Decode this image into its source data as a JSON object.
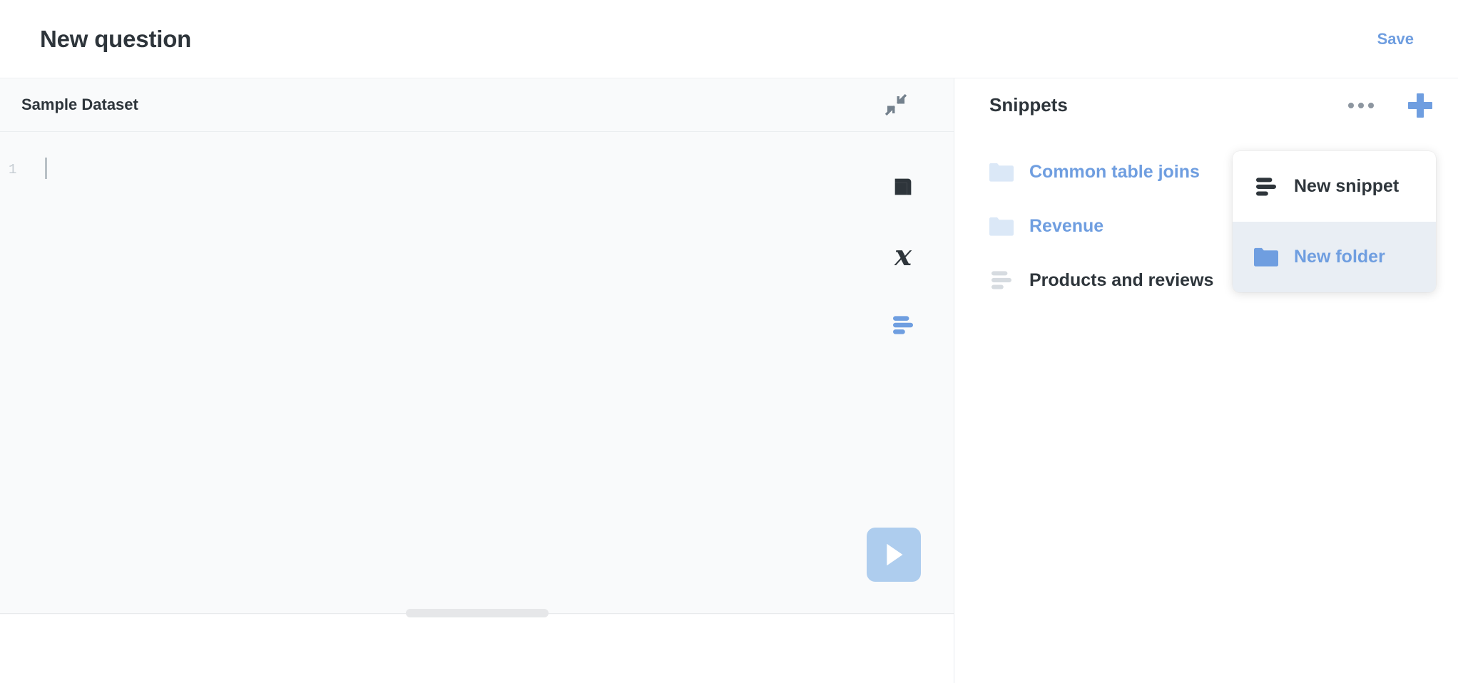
{
  "header": {
    "title": "New question",
    "save_label": "Save",
    "save_color": "#6f9ee0",
    "title_color": "#2e353b"
  },
  "editor": {
    "dataset_name": "Sample Dataset",
    "collapse_icon": "collapse-arrows-icon",
    "line_number": "1",
    "code_value": "",
    "rail_icons": [
      {
        "name": "data-reference-icon",
        "color": "#2e353b"
      },
      {
        "name": "variables-icon",
        "glyph": "x",
        "color": "#2e353b"
      },
      {
        "name": "snippets-icon",
        "color": "#6f9ee0"
      }
    ],
    "run_button": {
      "name": "run-query-button",
      "icon": "play-icon",
      "background": "#aecdee"
    },
    "drag_handle": "resize-handle"
  },
  "snippets": {
    "title": "Snippets",
    "ellipsis_icon": "ellipsis-icon",
    "plus_icon": "plus-icon",
    "plus_color": "#6f9ee0",
    "items": [
      {
        "label": "Common table joins",
        "type": "folder",
        "icon": "folder-icon"
      },
      {
        "label": "Revenue",
        "type": "folder",
        "icon": "folder-icon"
      },
      {
        "label": "Products and reviews",
        "type": "snippet",
        "icon": "snippet-icon"
      }
    ]
  },
  "dropdown": {
    "items": [
      {
        "label": "New snippet",
        "icon": "snippet-icon",
        "highlighted": false
      },
      {
        "label": "New folder",
        "icon": "folder-icon",
        "highlighted": true
      }
    ],
    "highlight_color": "#e9eef4"
  }
}
